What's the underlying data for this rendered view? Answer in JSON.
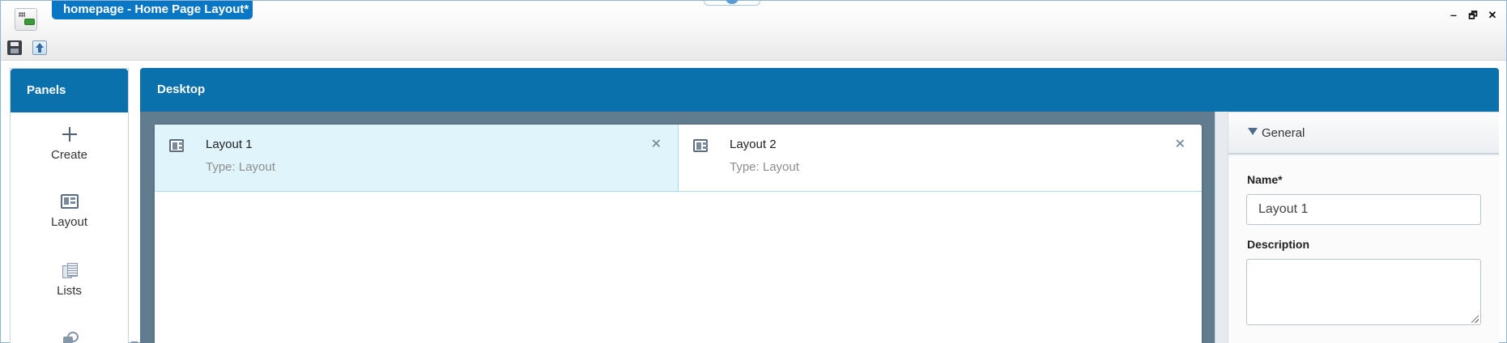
{
  "window": {
    "title": "homepage - Home Page Layout*",
    "controls": {
      "minimize": "‒",
      "restore": "🗗",
      "close": "✕"
    }
  },
  "toolbar": {
    "icons": [
      "save-icon",
      "publish-icon"
    ]
  },
  "panels": {
    "header": "Panels",
    "items": [
      {
        "label": "Create",
        "icon": "plus-icon"
      },
      {
        "label": "Layout",
        "icon": "layout-icon"
      },
      {
        "label": "Lists",
        "icon": "lists-icon"
      },
      {
        "label": "",
        "icon": "panel-more-icon"
      }
    ]
  },
  "desktop": {
    "header": "Desktop",
    "layouts": [
      {
        "name": "Layout 1",
        "type": "Type: Layout",
        "selected": true
      },
      {
        "name": "Layout 2",
        "type": "Type: Layout",
        "selected": false
      }
    ]
  },
  "properties": {
    "section": "General",
    "name_label": "Name*",
    "name_value": "Layout 1",
    "description_label": "Description",
    "description_value": ""
  },
  "colors": {
    "header_blue": "#0b71ad",
    "title_tab_blue": "#0a77c4",
    "selected_tab_bg": "#e0f4fc",
    "canvas_bg": "#627c8f"
  }
}
